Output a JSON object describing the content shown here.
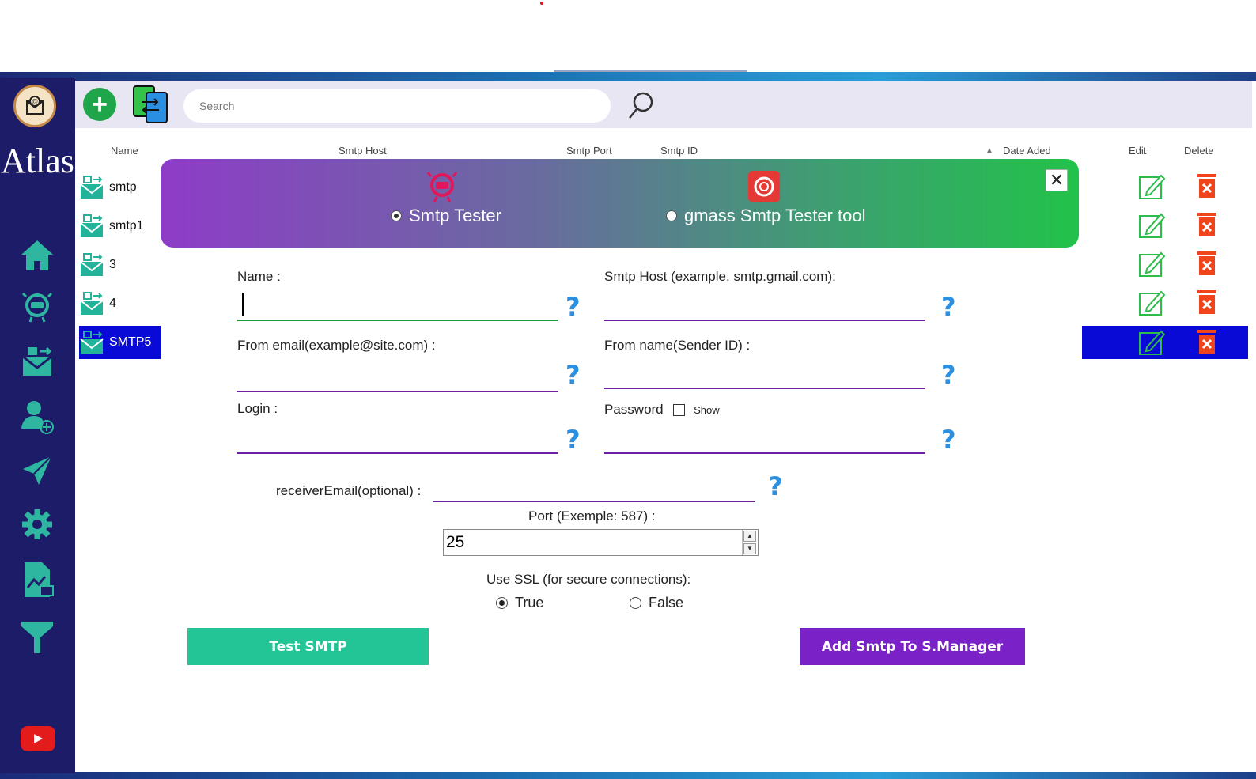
{
  "app": {
    "name": "Atlas"
  },
  "toolbar": {
    "search_placeholder": "Search"
  },
  "table": {
    "columns": {
      "name": "Name",
      "host": "Smtp Host",
      "port": "Smtp Port",
      "id": "Smtp ID",
      "date": "Date Aded",
      "edit": "Edit",
      "delete": "Delete"
    },
    "rows": [
      "smtp",
      "smtp1",
      "3",
      "4",
      "SMTP5"
    ],
    "selected_row": "SMTP5",
    "sort_indicator": "▲"
  },
  "modal": {
    "tabs": [
      {
        "label": "Smtp Tester",
        "selected": true
      },
      {
        "label": "gmass Smtp Tester tool",
        "selected": false
      }
    ],
    "close_label": "✕",
    "fields": {
      "name_label": "Name :",
      "host_label": "Smtp Host (example. smtp.gmail.com):",
      "from_email_label": "From email(example@site.com) :",
      "from_name_label": "From name(Sender ID) :",
      "login_label": "Login :",
      "password_label": "Password",
      "show_label": "Show",
      "receiver_label": "receiverEmail(optional) :",
      "port_label": "Port (Exemple: 587) :",
      "port_value": "25",
      "ssl_label": "Use SSL (for secure connections):",
      "ssl_true": "True",
      "ssl_false": "False",
      "ssl_selected": "True",
      "help": "?"
    },
    "buttons": {
      "test": "Test SMTP",
      "add": "Add Smtp To S.Manager"
    }
  },
  "colors": {
    "sidebar": "#1c1c68",
    "sidebar_icon": "#2fb6a0",
    "header_start": "#8e3cc8",
    "header_end": "#22c24a",
    "test_button": "#23c496",
    "add_button": "#7a22c8",
    "selected_row": "#0a0ad6",
    "help_icon": "#2b8fe2"
  }
}
